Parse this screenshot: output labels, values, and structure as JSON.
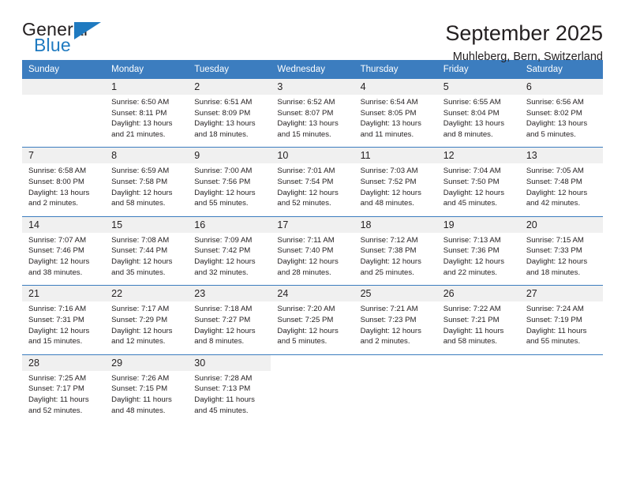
{
  "brand": {
    "name_part1": "General",
    "name_part2": "Blue",
    "flag_icon": "triangle-flag-icon"
  },
  "header": {
    "title": "September 2025",
    "subtitle": "Muhleberg, Bern, Switzerland"
  },
  "colors": {
    "header_blue": "#3c7dbf",
    "brand_blue": "#1f7ac0",
    "daynum_band": "#f0f0f0",
    "text": "#231f20"
  },
  "weekday_headers": [
    "Sunday",
    "Monday",
    "Tuesday",
    "Wednesday",
    "Thursday",
    "Friday",
    "Saturday"
  ],
  "weeks": [
    {
      "days": [
        {
          "num": "",
          "l1": "",
          "l2": "",
          "l3": "",
          "l4": ""
        },
        {
          "num": "1",
          "l1": "Sunrise: 6:50 AM",
          "l2": "Sunset: 8:11 PM",
          "l3": "Daylight: 13 hours",
          "l4": "and 21 minutes."
        },
        {
          "num": "2",
          "l1": "Sunrise: 6:51 AM",
          "l2": "Sunset: 8:09 PM",
          "l3": "Daylight: 13 hours",
          "l4": "and 18 minutes."
        },
        {
          "num": "3",
          "l1": "Sunrise: 6:52 AM",
          "l2": "Sunset: 8:07 PM",
          "l3": "Daylight: 13 hours",
          "l4": "and 15 minutes."
        },
        {
          "num": "4",
          "l1": "Sunrise: 6:54 AM",
          "l2": "Sunset: 8:05 PM",
          "l3": "Daylight: 13 hours",
          "l4": "and 11 minutes."
        },
        {
          "num": "5",
          "l1": "Sunrise: 6:55 AM",
          "l2": "Sunset: 8:04 PM",
          "l3": "Daylight: 13 hours",
          "l4": "and 8 minutes."
        },
        {
          "num": "6",
          "l1": "Sunrise: 6:56 AM",
          "l2": "Sunset: 8:02 PM",
          "l3": "Daylight: 13 hours",
          "l4": "and 5 minutes."
        }
      ]
    },
    {
      "days": [
        {
          "num": "7",
          "l1": "Sunrise: 6:58 AM",
          "l2": "Sunset: 8:00 PM",
          "l3": "Daylight: 13 hours",
          "l4": "and 2 minutes."
        },
        {
          "num": "8",
          "l1": "Sunrise: 6:59 AM",
          "l2": "Sunset: 7:58 PM",
          "l3": "Daylight: 12 hours",
          "l4": "and 58 minutes."
        },
        {
          "num": "9",
          "l1": "Sunrise: 7:00 AM",
          "l2": "Sunset: 7:56 PM",
          "l3": "Daylight: 12 hours",
          "l4": "and 55 minutes."
        },
        {
          "num": "10",
          "l1": "Sunrise: 7:01 AM",
          "l2": "Sunset: 7:54 PM",
          "l3": "Daylight: 12 hours",
          "l4": "and 52 minutes."
        },
        {
          "num": "11",
          "l1": "Sunrise: 7:03 AM",
          "l2": "Sunset: 7:52 PM",
          "l3": "Daylight: 12 hours",
          "l4": "and 48 minutes."
        },
        {
          "num": "12",
          "l1": "Sunrise: 7:04 AM",
          "l2": "Sunset: 7:50 PM",
          "l3": "Daylight: 12 hours",
          "l4": "and 45 minutes."
        },
        {
          "num": "13",
          "l1": "Sunrise: 7:05 AM",
          "l2": "Sunset: 7:48 PM",
          "l3": "Daylight: 12 hours",
          "l4": "and 42 minutes."
        }
      ]
    },
    {
      "days": [
        {
          "num": "14",
          "l1": "Sunrise: 7:07 AM",
          "l2": "Sunset: 7:46 PM",
          "l3": "Daylight: 12 hours",
          "l4": "and 38 minutes."
        },
        {
          "num": "15",
          "l1": "Sunrise: 7:08 AM",
          "l2": "Sunset: 7:44 PM",
          "l3": "Daylight: 12 hours",
          "l4": "and 35 minutes."
        },
        {
          "num": "16",
          "l1": "Sunrise: 7:09 AM",
          "l2": "Sunset: 7:42 PM",
          "l3": "Daylight: 12 hours",
          "l4": "and 32 minutes."
        },
        {
          "num": "17",
          "l1": "Sunrise: 7:11 AM",
          "l2": "Sunset: 7:40 PM",
          "l3": "Daylight: 12 hours",
          "l4": "and 28 minutes."
        },
        {
          "num": "18",
          "l1": "Sunrise: 7:12 AM",
          "l2": "Sunset: 7:38 PM",
          "l3": "Daylight: 12 hours",
          "l4": "and 25 minutes."
        },
        {
          "num": "19",
          "l1": "Sunrise: 7:13 AM",
          "l2": "Sunset: 7:36 PM",
          "l3": "Daylight: 12 hours",
          "l4": "and 22 minutes."
        },
        {
          "num": "20",
          "l1": "Sunrise: 7:15 AM",
          "l2": "Sunset: 7:33 PM",
          "l3": "Daylight: 12 hours",
          "l4": "and 18 minutes."
        }
      ]
    },
    {
      "days": [
        {
          "num": "21",
          "l1": "Sunrise: 7:16 AM",
          "l2": "Sunset: 7:31 PM",
          "l3": "Daylight: 12 hours",
          "l4": "and 15 minutes."
        },
        {
          "num": "22",
          "l1": "Sunrise: 7:17 AM",
          "l2": "Sunset: 7:29 PM",
          "l3": "Daylight: 12 hours",
          "l4": "and 12 minutes."
        },
        {
          "num": "23",
          "l1": "Sunrise: 7:18 AM",
          "l2": "Sunset: 7:27 PM",
          "l3": "Daylight: 12 hours",
          "l4": "and 8 minutes."
        },
        {
          "num": "24",
          "l1": "Sunrise: 7:20 AM",
          "l2": "Sunset: 7:25 PM",
          "l3": "Daylight: 12 hours",
          "l4": "and 5 minutes."
        },
        {
          "num": "25",
          "l1": "Sunrise: 7:21 AM",
          "l2": "Sunset: 7:23 PM",
          "l3": "Daylight: 12 hours",
          "l4": "and 2 minutes."
        },
        {
          "num": "26",
          "l1": "Sunrise: 7:22 AM",
          "l2": "Sunset: 7:21 PM",
          "l3": "Daylight: 11 hours",
          "l4": "and 58 minutes."
        },
        {
          "num": "27",
          "l1": "Sunrise: 7:24 AM",
          "l2": "Sunset: 7:19 PM",
          "l3": "Daylight: 11 hours",
          "l4": "and 55 minutes."
        }
      ]
    },
    {
      "days": [
        {
          "num": "28",
          "l1": "Sunrise: 7:25 AM",
          "l2": "Sunset: 7:17 PM",
          "l3": "Daylight: 11 hours",
          "l4": "and 52 minutes."
        },
        {
          "num": "29",
          "l1": "Sunrise: 7:26 AM",
          "l2": "Sunset: 7:15 PM",
          "l3": "Daylight: 11 hours",
          "l4": "and 48 minutes."
        },
        {
          "num": "30",
          "l1": "Sunrise: 7:28 AM",
          "l2": "Sunset: 7:13 PM",
          "l3": "Daylight: 11 hours",
          "l4": "and 45 minutes."
        },
        {
          "num": "",
          "l1": "",
          "l2": "",
          "l3": "",
          "l4": ""
        },
        {
          "num": "",
          "l1": "",
          "l2": "",
          "l3": "",
          "l4": ""
        },
        {
          "num": "",
          "l1": "",
          "l2": "",
          "l3": "",
          "l4": ""
        },
        {
          "num": "",
          "l1": "",
          "l2": "",
          "l3": "",
          "l4": ""
        }
      ]
    }
  ]
}
